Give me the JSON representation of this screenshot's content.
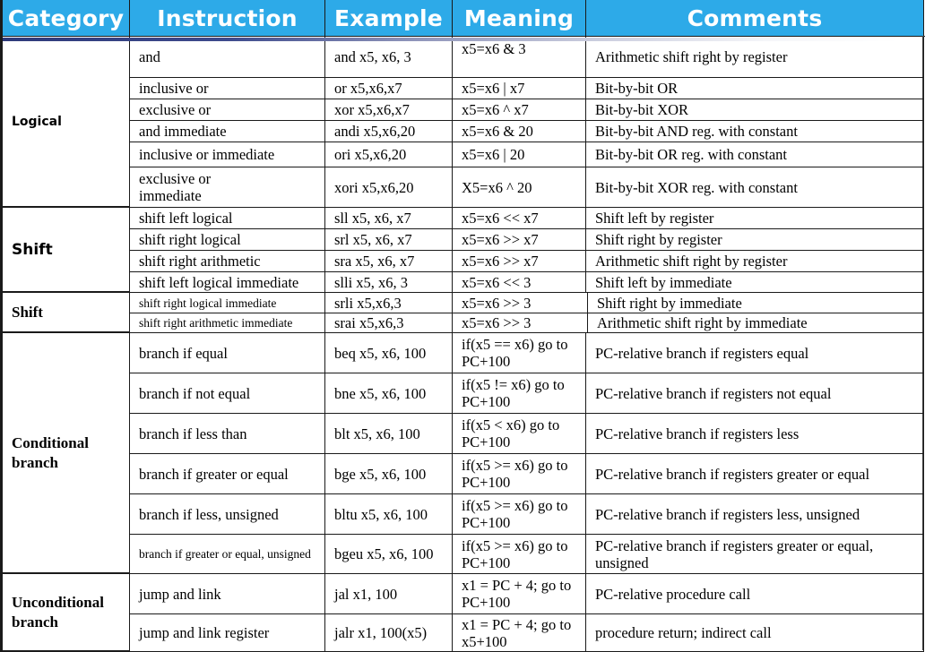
{
  "headers": [
    "Category",
    "Instruction",
    "Example",
    "Meaning",
    "Comments"
  ],
  "groups": [
    {
      "name": "Logical",
      "rows": [
        {
          "instruction": "and",
          "example": "and x5, x6, 3",
          "meaning": "x5=x6 & 3",
          "comment": "Arithmetic shift right by register"
        },
        {
          "instruction": "inclusive or",
          "example": "or x5,x6,x7",
          "meaning": "x5=x6 | x7",
          "comment": "Bit-by-bit OR"
        },
        {
          "instruction": "exclusive or",
          "example": "xor x5,x6,x7",
          "meaning": "x5=x6 ^ x7",
          "comment": "Bit-by-bit XOR"
        },
        {
          "instruction": "and immediate",
          "example": "andi x5,x6,20",
          "meaning": "x5=x6 & 20",
          "comment": "Bit-by-bit AND reg. with constant"
        },
        {
          "instruction": "inclusive or immediate",
          "example": "ori x5,x6,20",
          "meaning": "x5=x6 | 20",
          "comment": "Bit-by-bit OR reg. with constant"
        },
        {
          "instruction": "exclusive or immediate",
          "example": "xori x5,x6,20",
          "meaning": "X5=x6 ^ 20",
          "comment": "Bit-by-bit XOR reg. with constant"
        }
      ]
    },
    {
      "name": "Shift",
      "rows": [
        {
          "instruction": "shift left logical",
          "example": "sll x5, x6, x7",
          "meaning": "x5=x6 << x7",
          "comment": "Shift left by register"
        },
        {
          "instruction": "shift right logical",
          "example": "srl x5, x6, x7",
          "meaning": "x5=x6 >> x7",
          "comment": "Shift right by register"
        },
        {
          "instruction": "shift right arithmetic",
          "example": "sra x5, x6, x7",
          "meaning": "x5=x6 >> x7",
          "comment": "Arithmetic shift right by register"
        },
        {
          "instruction": "shift left logical immediate",
          "example": "slli x5, x6, 3",
          "meaning": "x5=x6 << 3",
          "comment": "Shift left by immediate"
        }
      ]
    },
    {
      "name": "Shift",
      "rows": [
        {
          "instruction": "shift right logical immediate",
          "example": "srli x5,x6,3",
          "meaning": "x5=x6 >> 3",
          "comment": "Shift right by immediate"
        },
        {
          "instruction": "shift right arithmetic immediate",
          "example": "srai x5,x6,3",
          "meaning": "x5=x6 >> 3",
          "comment": "Arithmetic shift right by immediate"
        }
      ]
    },
    {
      "name": "Conditional branch",
      "rows": [
        {
          "instruction": "branch if equal",
          "example": "beq x5, x6, 100",
          "meaning": "if(x5 == x6) go to PC+100",
          "comment": "PC-relative branch if registers equal"
        },
        {
          "instruction": "branch if not equal",
          "example": "bne x5, x6, 100",
          "meaning": "if(x5 != x6) go to PC+100",
          "comment": "PC-relative branch if registers not equal"
        },
        {
          "instruction": "branch if less than",
          "example": "blt x5, x6, 100",
          "meaning": "if(x5 < x6) go to PC+100",
          "comment": "PC-relative branch if registers less"
        },
        {
          "instruction": "branch if greater or equal",
          "example": "bge x5, x6, 100",
          "meaning": "if(x5 >= x6) go to PC+100",
          "comment": "PC-relative branch if registers greater or equal"
        },
        {
          "instruction": "branch if less, unsigned",
          "example": "bltu x5, x6, 100",
          "meaning": "if(x5 >= x6) go to PC+100",
          "comment": "PC-relative branch if registers less, unsigned"
        },
        {
          "instruction": "branch if greater or equal, unsigned",
          "example": "bgeu x5, x6, 100",
          "meaning": "if(x5 >= x6) go to PC+100",
          "comment": "PC-relative branch if registers greater or equal, unsigned"
        }
      ]
    },
    {
      "name": "Unconditional branch",
      "rows": [
        {
          "instruction": "jump and link",
          "example": "jal x1, 100",
          "meaning": "x1 = PC + 4; go to PC+100",
          "comment": "PC-relative procedure call"
        },
        {
          "instruction": "jump and link register",
          "example": "jalr x1, 100(x5)",
          "meaning": "x1 = PC + 4; go to x5+100",
          "comment": "procedure return; indirect call"
        }
      ]
    }
  ]
}
